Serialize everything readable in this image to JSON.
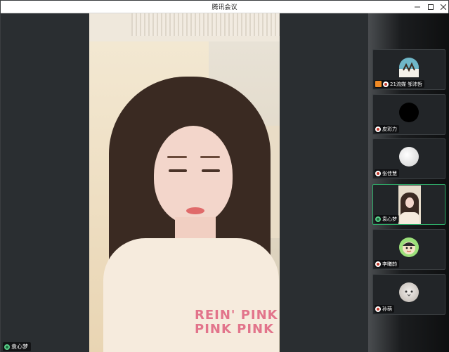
{
  "window": {
    "title": "腾讯会议"
  },
  "main_video": {
    "speaker_name": "袁心梦",
    "shirt_print": "REIN' PINK\nPINK PINK"
  },
  "participants": [
    {
      "name": "21流媒 邹沛哲",
      "avatar": "photo-avatar",
      "avatar_color": "#6fb7c8",
      "host": true,
      "mic": "muted"
    },
    {
      "name": "皮彩力",
      "avatar": "black-circle-avatar",
      "avatar_color": "#000000",
      "host": false,
      "mic": "muted"
    },
    {
      "name": "张佳慧",
      "avatar": "white-fabric-avatar",
      "avatar_color": "#e8e8e8",
      "host": false,
      "mic": "muted"
    },
    {
      "name": "袁心梦",
      "avatar": "live-video",
      "avatar_color": "#e7ddcc",
      "host": false,
      "mic": "on",
      "active": true
    },
    {
      "name": "李曦韵",
      "avatar": "cartoon-avatar",
      "avatar_color": "#9be07a",
      "host": false,
      "mic": "muted"
    },
    {
      "name": "孙萌",
      "avatar": "cat-avatar",
      "avatar_color": "#d9d4cf",
      "host": false,
      "mic": "muted"
    }
  ],
  "colors": {
    "active_border": "#2fae6a",
    "host_badge": "#f08a24",
    "mic_muted": "#c0392b",
    "mic_on": "#5ad08a"
  }
}
